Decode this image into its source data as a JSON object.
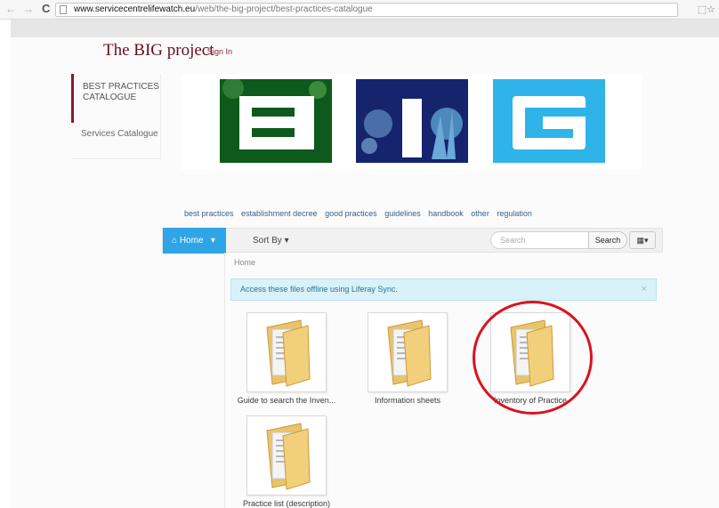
{
  "browser": {
    "url_host": "www.servicecentrelifewatch.eu",
    "url_path": "/web/the-big-project/best-practices-catalogue"
  },
  "site": {
    "title": "The BIG project",
    "signin": "Sign In"
  },
  "sidenav": {
    "items": [
      {
        "label": "BEST PRACTICES CATALOGUE",
        "active": true
      },
      {
        "label": "Services Catalogue",
        "active": false
      }
    ]
  },
  "logo": {
    "letters": [
      "B",
      "I",
      "G"
    ]
  },
  "tags": [
    "best practices",
    "establishment decree",
    "good practices",
    "guidelines",
    "handbook",
    "other",
    "regulation"
  ],
  "toolbar": {
    "home": "Home",
    "sort_by": "Sort By",
    "search_placeholder": "Search",
    "search_button": "Search"
  },
  "breadcrumb": "Home",
  "alert": {
    "text": "Access these files offline using Liferay Sync.",
    "close": "×"
  },
  "entries": [
    {
      "title": "Guide to search the Inven..."
    },
    {
      "title": "Information sheets"
    },
    {
      "title": "Inventory of Practice"
    },
    {
      "title": "Practice list (description)"
    }
  ],
  "colors": {
    "accent": "#2fa4e7",
    "title": "#6a0f1a",
    "highlight": "#d9131e"
  }
}
